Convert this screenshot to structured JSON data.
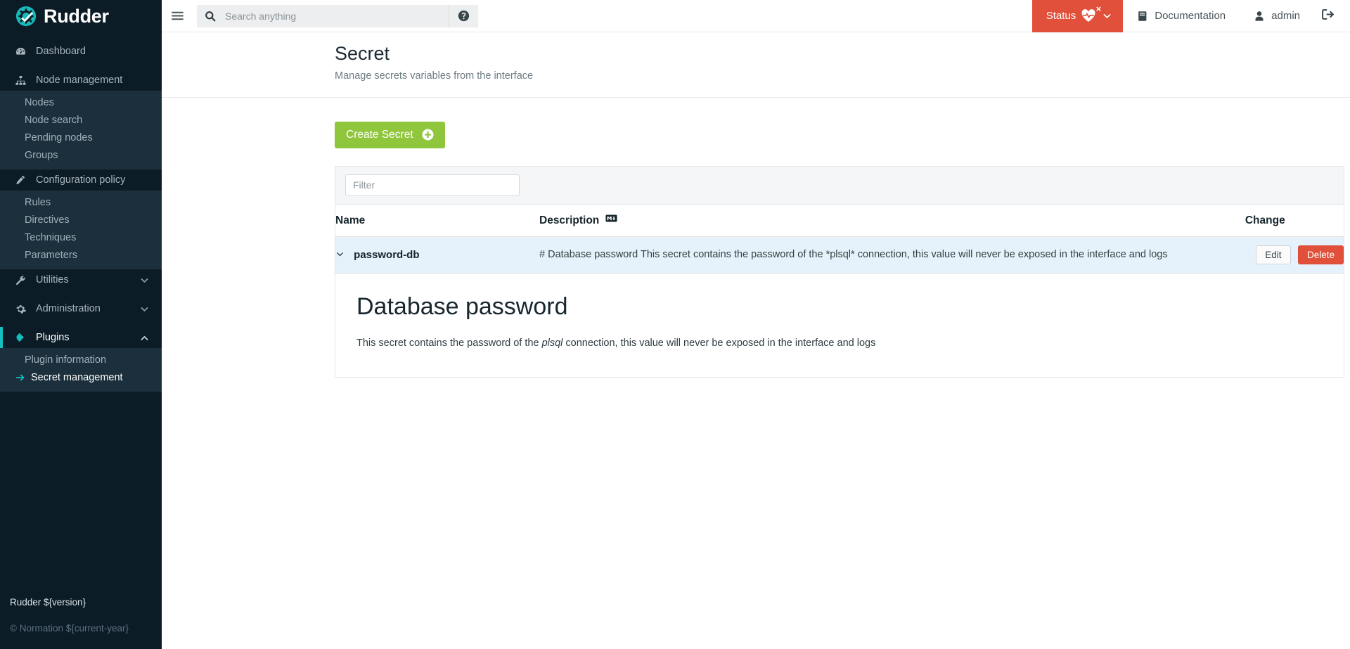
{
  "brand": {
    "name": "Rudder",
    "logo_icon": "rudder-gear-check-icon"
  },
  "sidebar": {
    "items": [
      {
        "label": "Dashboard",
        "icon": "gauge-icon"
      },
      {
        "label": "Node management",
        "icon": "sitemap-icon"
      },
      {
        "label": "Configuration policy",
        "icon": "pencil-icon"
      },
      {
        "label": "Utilities",
        "icon": "wrench-icon"
      },
      {
        "label": "Administration",
        "icon": "gear-icon"
      },
      {
        "label": "Plugins",
        "icon": "puzzle-piece-icon"
      }
    ],
    "node_management_sub": [
      "Nodes",
      "Node search",
      "Pending nodes",
      "Groups"
    ],
    "configuration_sub": [
      "Rules",
      "Directives",
      "Techniques",
      "Parameters"
    ],
    "plugins_sub": [
      "Plugin information",
      "Secret management"
    ],
    "active_item": "Plugins",
    "active_sub_item": "Secret management",
    "accent_color": "#15bfbf",
    "footer": {
      "version": "Rudder ${version}",
      "copyright": "© Normation ${current-year}"
    }
  },
  "topbar": {
    "menu_toggle_icon": "hamburger-icon",
    "search": {
      "placeholder": "Search anything",
      "value": "",
      "icon": "search-icon",
      "help_icon": "question-circle-icon"
    },
    "status": {
      "label": "Status",
      "icon": "heart-pulse-error-icon",
      "chevron": "chevron-down-icon",
      "color": "#e0503a"
    },
    "documentation": {
      "label": "Documentation",
      "icon": "book-icon"
    },
    "user": {
      "label": "admin",
      "icon": "user-icon"
    },
    "logout": {
      "icon": "sign-out-icon"
    }
  },
  "page": {
    "title": "Secret",
    "subtitle": "Manage secrets variables from the interface",
    "create_button": {
      "label": "Create Secret",
      "icon": "plus-circle-icon",
      "color": "#8fc63c"
    }
  },
  "table": {
    "filter": {
      "placeholder": "Filter",
      "value": ""
    },
    "columns": [
      "Name",
      "Description",
      "Change"
    ],
    "description_badge_icon": "markdown-icon",
    "rows": [
      {
        "expander_icon": "chevron-down-icon",
        "name": "password-db",
        "description": "# Database password This secret contains the password of the *plsql* connection, this value will never be exposed in the interface and logs",
        "edit_label": "Edit",
        "delete_label": "Delete",
        "expanded": true,
        "detail": {
          "heading": "Database password",
          "text_before": "This secret contains the password of the ",
          "emphasis": "plsql",
          "text_after": " connection, this value will never be exposed in the interface and logs"
        }
      }
    ]
  }
}
